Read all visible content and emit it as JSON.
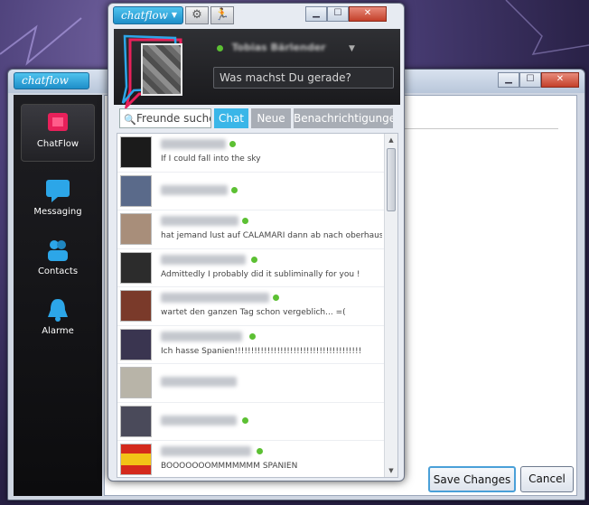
{
  "app": {
    "logo_text": "chatflow"
  },
  "back_window": {
    "logo_text": "chatflow",
    "sidebar": {
      "items": [
        {
          "label": "ChatFlow",
          "icon": "chatflow-icon",
          "color": "#e8205a"
        },
        {
          "label": "Messaging",
          "icon": "chat-bubble-icon",
          "color": "#2ca6e8"
        },
        {
          "label": "Contacts",
          "icon": "contacts-icon",
          "color": "#2ca6e8"
        },
        {
          "label": "Alarme",
          "icon": "bell-icon",
          "color": "#2ca6e8"
        }
      ]
    },
    "buttons": {
      "save": "Save Changes",
      "cancel": "Cancel"
    }
  },
  "popup": {
    "status_placeholder": "Was machst Du gerade?",
    "user_name": "Tobias Bärlender",
    "search_placeholder": "Freunde suchen",
    "tabs": [
      {
        "label": "Chat",
        "active": true
      },
      {
        "label": "Neue",
        "active": false
      },
      {
        "label": "Benachrichtigungen",
        "active": false
      }
    ],
    "contacts": [
      {
        "message": "If I could fall into the sky",
        "thumb": "#1b1b1b"
      },
      {
        "message": "",
        "thumb": "#5a6a8a"
      },
      {
        "message": "hat jemand lust auf  CALAMARI dann ab nach oberhaus...",
        "thumb": "#a88e7a"
      },
      {
        "message": "Admittedly I probably did it subliminally for you !",
        "thumb": "#2c2c2c"
      },
      {
        "message": "wartet den ganzen Tag schon vergeblich... =(",
        "thumb": "#7a3a2a"
      },
      {
        "message": "Ich hasse Spanien!!!!!!!!!!!!!!!!!!!!!!!!!!!!!!!!!!!!!!!",
        "thumb": "#3a3550"
      },
      {
        "message": "",
        "thumb": "#b8b4a8"
      },
      {
        "message": "",
        "thumb": "#4a4a5a"
      },
      {
        "message": "BOOOOOOOMMMMMMM SPANIEN",
        "thumb": "#d42a1c"
      }
    ]
  },
  "colors": {
    "accent": "#3ab6e8",
    "online": "#5cc033",
    "brand_pink": "#e8205a"
  }
}
